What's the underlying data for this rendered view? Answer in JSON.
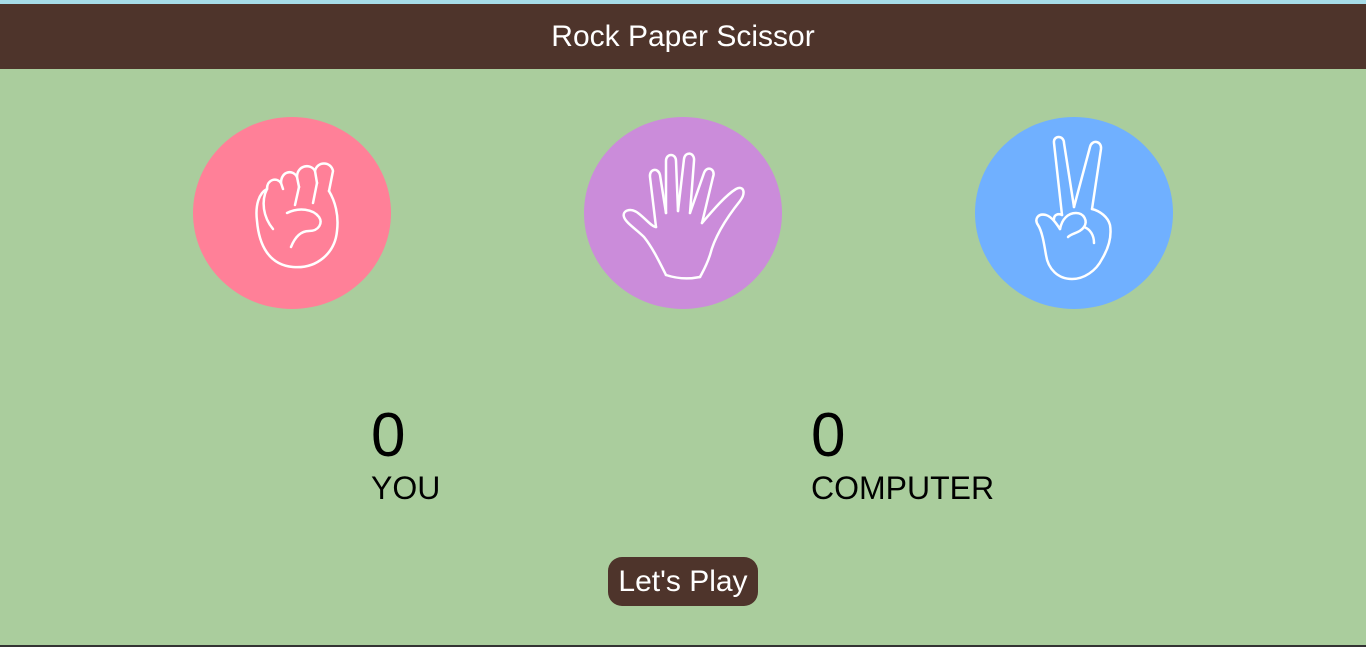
{
  "header": {
    "title": "Rock Paper Scissor"
  },
  "choices": [
    {
      "name": "rock",
      "icon": "fist-icon",
      "color": "#ff8098"
    },
    {
      "name": "paper",
      "icon": "open-hand-icon",
      "color": "#cb8cda"
    },
    {
      "name": "scissors",
      "icon": "peace-hand-icon",
      "color": "#70b0ff"
    }
  ],
  "score": {
    "you": {
      "value": "0",
      "label": "YOU"
    },
    "computer": {
      "value": "0",
      "label": "COMPUTER"
    }
  },
  "play_button": {
    "label": "Let's Play"
  },
  "colors": {
    "background": "#aacd9d",
    "header": "#4e342b",
    "accent_strip": "#a6dce8"
  }
}
